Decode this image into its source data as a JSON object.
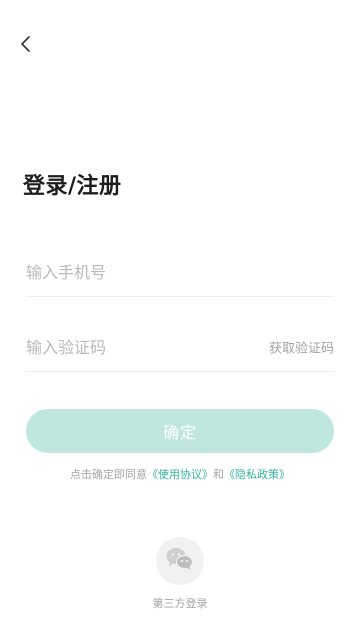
{
  "header": {
    "back_icon": "chevron-left-icon"
  },
  "page": {
    "title": "登录/注册"
  },
  "form": {
    "phone_placeholder": "输入手机号",
    "phone_value": "",
    "code_placeholder": "输入验证码",
    "code_value": "",
    "get_code_label": "获取验证码"
  },
  "confirm_button": {
    "label": "确定"
  },
  "agreement": {
    "prefix": "点击确定即同意",
    "terms_link": "《使用协议》",
    "joiner": "和",
    "privacy_link": "《隐私政策》"
  },
  "third_party": {
    "icon": "wechat-icon",
    "label": "第三方登录"
  },
  "colors": {
    "accent": "#36b4a2",
    "button_disabled": "#bfe6df"
  }
}
